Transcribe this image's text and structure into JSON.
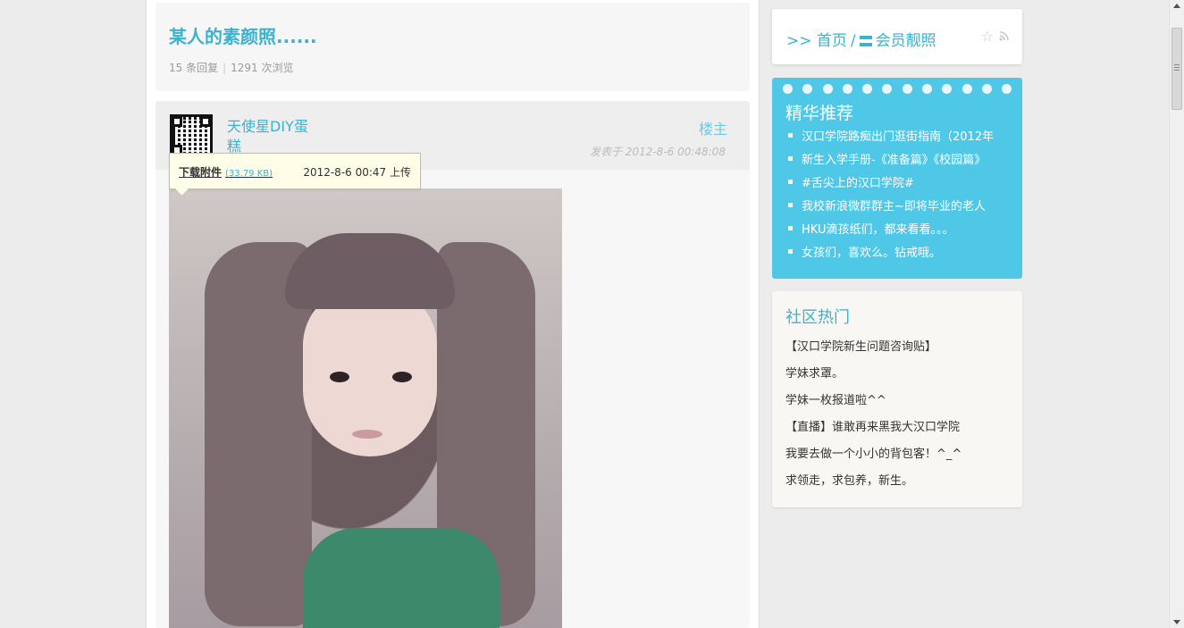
{
  "thread": {
    "title": "某人的素颜照......",
    "replies": "15 条回复",
    "stat_separator": "|",
    "views": "1291 次浏览"
  },
  "post": {
    "author": "天使星DIY蛋糕",
    "floor": "楼主",
    "time": "发表于 2012-8-6 00:48:08",
    "attachment": {
      "download_label": "下载附件",
      "size": "(33.79 KB)",
      "uploaded": "2012-8-6 00:47 上传"
    }
  },
  "breadcrumb": {
    "prefix": ">>",
    "home": "首页",
    "separator": "/",
    "section": "会员靓照"
  },
  "featured": {
    "title": "精华推荐",
    "items": [
      "汉口学院路痴出门逛街指南（2012年",
      "新生入学手册-《准备篇》《校园篇》",
      "#舌尖上的汉口学院#",
      "我校新浪微群群主~即将毕业的老人",
      "HKU滴孩纸们，都来看看。。。",
      "女孩们，喜欢么。钻戒哦。"
    ]
  },
  "hot": {
    "title": "社区热门",
    "items": [
      "【汉口学院新生问题咨询贴】",
      "学妹求罩。",
      "学妹一枚报道啦^^",
      "【直播】谁敢再来黑我大汉口学院",
      "我要去做一个小小的背包客！^_^",
      "求领走，求包养，新生。"
    ]
  },
  "colors": {
    "accent": "#3bb2d0",
    "featured_bg": "#4fc7e7",
    "hot_bg": "#f8f7f3"
  },
  "icons": [
    "menu-icon",
    "star-icon",
    "rss-icon",
    "qr-code-avatar"
  ]
}
